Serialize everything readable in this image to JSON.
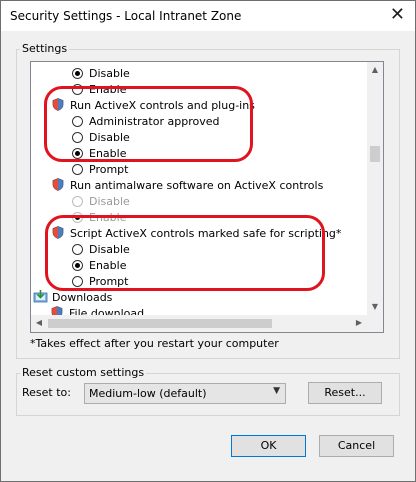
{
  "window": {
    "title": "Security Settings - Local Intranet Zone"
  },
  "settings": {
    "group_label": "Settings",
    "items": [
      {
        "text": "Disable",
        "kind": "radio",
        "checked": true,
        "enabled": true
      },
      {
        "text": "Enable",
        "kind": "radio",
        "checked": false,
        "enabled": true
      },
      {
        "text": "Run ActiveX controls and plug-ins",
        "kind": "category",
        "icon": "shield-icon"
      },
      {
        "text": "Administrator approved",
        "kind": "radio",
        "checked": false,
        "enabled": true
      },
      {
        "text": "Disable",
        "kind": "radio",
        "checked": false,
        "enabled": true
      },
      {
        "text": "Enable",
        "kind": "radio",
        "checked": true,
        "enabled": true
      },
      {
        "text": "Prompt",
        "kind": "radio",
        "checked": false,
        "enabled": true
      },
      {
        "text": "Run antimalware software on ActiveX controls",
        "kind": "category",
        "icon": "shield-icon"
      },
      {
        "text": "Disable",
        "kind": "radio",
        "checked": false,
        "enabled": false
      },
      {
        "text": "Enable",
        "kind": "radio",
        "checked": true,
        "enabled": false
      },
      {
        "text": "Script ActiveX controls marked safe for scripting*",
        "kind": "category",
        "icon": "shield-icon"
      },
      {
        "text": "Disable",
        "kind": "radio",
        "checked": false,
        "enabled": true
      },
      {
        "text": "Enable",
        "kind": "radio",
        "checked": true,
        "enabled": true
      },
      {
        "text": "Prompt",
        "kind": "radio",
        "checked": false,
        "enabled": true
      },
      {
        "text": "Downloads",
        "kind": "category",
        "icon": "download-icon"
      },
      {
        "text": "File download",
        "kind": "category",
        "icon": "shield-icon"
      }
    ],
    "footnote": "*Takes effect after you restart your computer"
  },
  "reset": {
    "group_label": "Reset custom settings",
    "label": "Reset to:",
    "selected": "Medium-low (default)",
    "button": "Reset..."
  },
  "buttons": {
    "ok": "OK",
    "cancel": "Cancel"
  },
  "colors": {
    "highlight": "#e0141f",
    "accent": "#0078d7"
  }
}
